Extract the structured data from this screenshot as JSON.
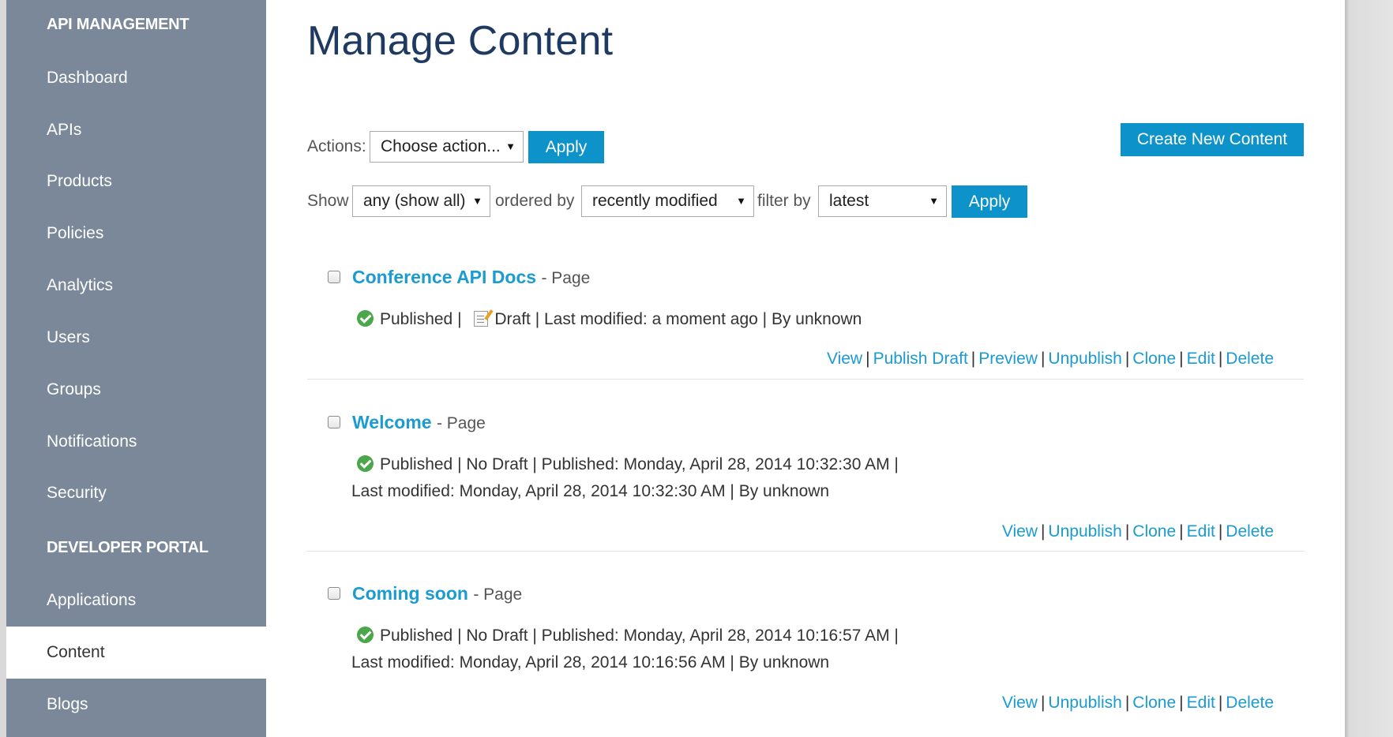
{
  "sidebar": {
    "sections": [
      {
        "label": "API MANAGEMENT"
      },
      {
        "label": "DEVELOPER PORTAL"
      }
    ],
    "items": [
      {
        "label": "Dashboard"
      },
      {
        "label": "APIs"
      },
      {
        "label": "Products"
      },
      {
        "label": "Policies"
      },
      {
        "label": "Analytics"
      },
      {
        "label": "Users"
      },
      {
        "label": "Groups"
      },
      {
        "label": "Notifications"
      },
      {
        "label": "Security"
      },
      {
        "label": "Applications"
      },
      {
        "label": "Content"
      },
      {
        "label": "Blogs"
      }
    ],
    "active_item": "Content"
  },
  "page": {
    "title": "Manage Content",
    "create_button": "Create New Content"
  },
  "actions_bar": {
    "label": "Actions:",
    "select_value": "Choose action...",
    "apply": "Apply"
  },
  "filter_bar": {
    "show_label": "Show",
    "show_value": "any (show all)",
    "ordered_label": "ordered by",
    "ordered_value": "recently modified",
    "filter_label": "filter by",
    "filter_value": "latest",
    "apply": "Apply"
  },
  "items": [
    {
      "title": "Conference API Docs",
      "type": "- Page",
      "published": "Published |",
      "draft": "Draft | Last modified: a moment ago | By unknown",
      "actions": [
        "View",
        "Publish Draft",
        "Preview",
        "Unpublish",
        "Clone",
        "Edit",
        "Delete"
      ]
    },
    {
      "title": "Welcome",
      "type": "- Page",
      "line1": "Published | No Draft | Published: Monday, April 28, 2014 10:32:30 AM |",
      "line2": "Last modified: Monday, April 28, 2014 10:32:30 AM | By unknown",
      "actions": [
        "View",
        "Unpublish",
        "Clone",
        "Edit",
        "Delete"
      ]
    },
    {
      "title": "Coming soon",
      "type": "- Page",
      "line1": "Published | No Draft | Published: Monday, April 28, 2014 10:16:57 AM |",
      "line2": "Last modified: Monday, April 28, 2014 10:16:56 AM | By unknown",
      "actions": [
        "View",
        "Unpublish",
        "Clone",
        "Edit",
        "Delete"
      ]
    }
  ],
  "icons": {
    "status_published": "check-circle-icon",
    "status_draft": "draft-document-icon",
    "select_caret": "caret-down-icon"
  },
  "colors": {
    "sidebar_bg": "#7a8899",
    "accent": "#0d93c9",
    "link": "#1a9bd1",
    "title": "#1f3a60",
    "success": "#4ca64c"
  }
}
